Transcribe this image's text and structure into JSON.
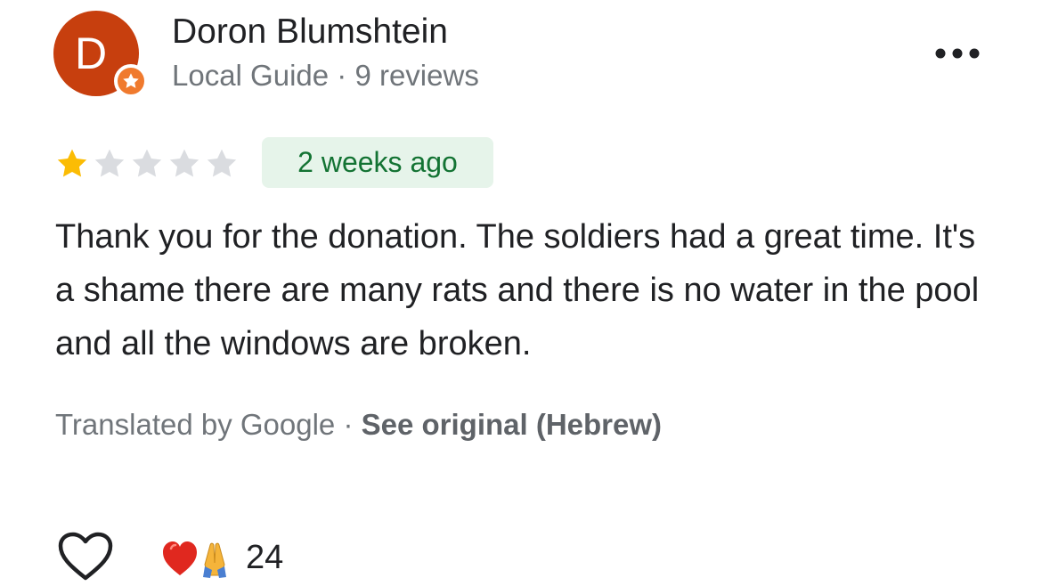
{
  "author": {
    "initial": "D",
    "name": "Doron Blumshtein",
    "meta": "Local Guide · 9 reviews"
  },
  "review": {
    "rating": 1,
    "rating_max": 5,
    "time": "2 weeks ago",
    "text": "Thank you for the donation. The soldiers had a great time. It's a shame there are many rats and there is no water in the pool and all the windows are broken.",
    "translation_prefix": "Translated by Google · ",
    "see_original": "See original (Hebrew)"
  },
  "reactions": {
    "emojis": "❤️🙏",
    "count": "24"
  },
  "colors": {
    "avatar": "#c73f0e",
    "badge": "#f07a2e",
    "star_filled": "#fbbc04",
    "star_empty": "#dadce0",
    "chip_bg": "#e6f4ea",
    "chip_text": "#137333"
  },
  "icons": {
    "badge": "star-badge-icon",
    "more": "more-horizontal-icon",
    "like": "heart-outline-icon"
  }
}
